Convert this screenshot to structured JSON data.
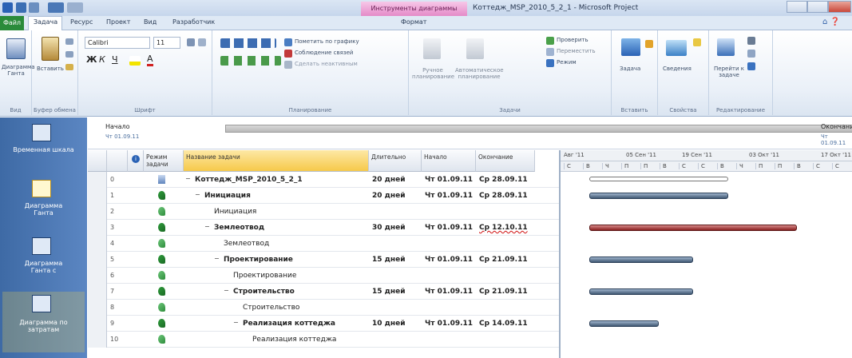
{
  "window": {
    "context_tab": "Инструменты диаграммы Ганта",
    "title": "Коттедж_MSP_2010_5_2_1 - Microsoft Project"
  },
  "tabs": [
    "Файл",
    "Задача",
    "Ресурс",
    "Проект",
    "Вид",
    "Разработчик",
    "Формат"
  ],
  "ribbon": {
    "view_group": {
      "button": "Диаграмма Ганта",
      "label": "Вид"
    },
    "clipboard_group": {
      "paste": "Вставить",
      "label": "Буфер обмена"
    },
    "font_group": {
      "font_name": "Calibri",
      "font_size": "11",
      "label": "Шрифт"
    },
    "schedule_group": {
      "mark_on_track": "Пометить по графику",
      "respect_links": "Соблюдение связей",
      "inactivate": "Сделать неактивным",
      "label": "Планирование"
    },
    "tasks_group": {
      "manual": "Ручное планирование",
      "auto": "Автоматическое планирование",
      "inspect": "Проверить",
      "move": "Переместить",
      "mode": "Режим",
      "label": "Задачи"
    },
    "insert_group": {
      "task": "Задача",
      "label": "Вставить"
    },
    "properties_group": {
      "info": "Сведения",
      "label": "Свойства"
    },
    "editing_group": {
      "goto": "Перейти к задаче",
      "label": "Редактирование"
    }
  },
  "views": [
    {
      "label": "Временная шкала"
    },
    {
      "label": "Диаграмма Ганта"
    },
    {
      "label": "Диаграмма Ганта с"
    },
    {
      "label": "Диаграмма по затратам"
    }
  ],
  "timeline": {
    "start_label": "Начало",
    "start_date": "Чт 01.09.11",
    "end_label": "Окончание",
    "end_date": "Чт 01.09.11"
  },
  "columns": {
    "info": "i",
    "mode": "Режим задачи",
    "name": "Название задачи",
    "duration": "Длительно",
    "start": "Начало",
    "finish": "Окончание"
  },
  "rows": [
    {
      "id": "0",
      "name": "Коттедж_MSP_2010_5_2_1",
      "duration": "20 дней",
      "start": "Чт 01.09.11",
      "finish": "Ср 28.09.11",
      "bold": true,
      "indent": 0,
      "collapse": true,
      "mode": "summary"
    },
    {
      "id": "1",
      "name": "Инициация",
      "duration": "20 дней",
      "start": "Чт 01.09.11",
      "finish": "Ср 28.09.11",
      "bold": true,
      "indent": 1,
      "collapse": true,
      "mode": "auto"
    },
    {
      "id": "2",
      "name": "Инициация",
      "duration": "",
      "start": "",
      "finish": "",
      "bold": false,
      "indent": 2,
      "collapse": false,
      "mode": "manual"
    },
    {
      "id": "3",
      "name": "Землеотвод",
      "duration": "30 дней",
      "start": "Чт 01.09.11",
      "finish": "Ср 12.10.11",
      "bold": true,
      "indent": 2,
      "collapse": true,
      "mode": "auto",
      "finish_underline": true
    },
    {
      "id": "4",
      "name": "Землеотвод",
      "duration": "",
      "start": "",
      "finish": "",
      "bold": false,
      "indent": 3,
      "collapse": false,
      "mode": "manual"
    },
    {
      "id": "5",
      "name": "Проектирование",
      "duration": "15 дней",
      "start": "Чт 01.09.11",
      "finish": "Ср 21.09.11",
      "bold": true,
      "indent": 3,
      "collapse": true,
      "mode": "auto"
    },
    {
      "id": "6",
      "name": "Проектирование",
      "duration": "",
      "start": "",
      "finish": "",
      "bold": false,
      "indent": 4,
      "collapse": false,
      "mode": "manual"
    },
    {
      "id": "7",
      "name": "Строительство",
      "duration": "15 дней",
      "start": "Чт 01.09.11",
      "finish": "Ср 21.09.11",
      "bold": true,
      "indent": 4,
      "collapse": true,
      "mode": "auto"
    },
    {
      "id": "8",
      "name": "Строительство",
      "duration": "",
      "start": "",
      "finish": "",
      "bold": false,
      "indent": 5,
      "collapse": false,
      "mode": "manual"
    },
    {
      "id": "9",
      "name": "Реализация коттеджа",
      "duration": "10 дней",
      "start": "Чт 01.09.11",
      "finish": "Ср 14.09.11",
      "bold": true,
      "indent": 5,
      "collapse": true,
      "mode": "auto"
    },
    {
      "id": "10",
      "name": "Реализация коттеджа",
      "duration": "",
      "start": "",
      "finish": "",
      "bold": false,
      "indent": 6,
      "collapse": false,
      "mode": "manual"
    }
  ],
  "gantt": {
    "weeks": [
      "Авг '11",
      "05 Сен '11",
      "19 Сен '11",
      "03 Окт '11",
      "17 Окт '11"
    ],
    "days": [
      "С",
      "В",
      "Ч",
      "П",
      "П",
      "В",
      "С",
      "С",
      "В",
      "Ч",
      "П",
      "П",
      "В",
      "С",
      "С"
    ],
    "bars": [
      {
        "row": 0,
        "type": "summary",
        "start_day": 0,
        "days": 28
      },
      {
        "row": 1,
        "type": "normal",
        "start_day": 0,
        "days": 28
      },
      {
        "row": 3,
        "type": "critical",
        "start_day": 0,
        "days": 42
      },
      {
        "row": 5,
        "type": "normal",
        "start_day": 0,
        "days": 21
      },
      {
        "row": 7,
        "type": "normal",
        "start_day": 0,
        "days": 21
      },
      {
        "row": 9,
        "type": "normal",
        "start_day": 0,
        "days": 14
      }
    ]
  },
  "colors": {
    "critical": "#8a2020",
    "normal_bar": "#405873",
    "accent": "#f4d24a"
  }
}
